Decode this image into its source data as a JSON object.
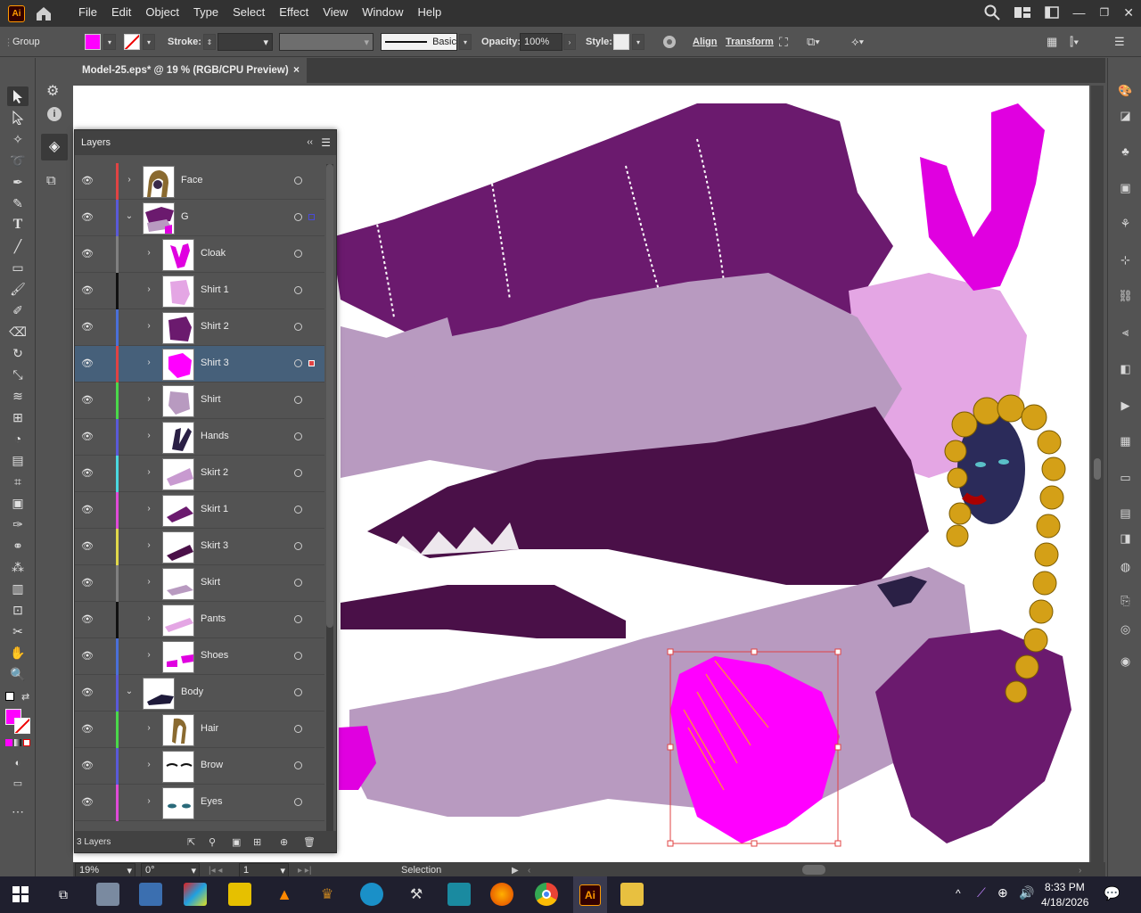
{
  "menubar": {
    "app_logo": "Ai",
    "items": [
      "File",
      "Edit",
      "Object",
      "Type",
      "Select",
      "Effect",
      "View",
      "Window",
      "Help"
    ]
  },
  "control_bar": {
    "selection_type": "Group",
    "stroke_label": "Stroke:",
    "brush_label": "Basic",
    "opacity_label": "Opacity:",
    "opacity_value": "100%",
    "style_label": "Style:",
    "align_label": "Align",
    "transform_label": "Transform",
    "fill_color": "#ff00ff"
  },
  "document": {
    "tab_title": "Model-25.eps* @ 19 % (RGB/CPU Preview)",
    "close_glyph": "×"
  },
  "layers_panel": {
    "title": "Layers",
    "footer_count": "3 Layers",
    "rows": [
      {
        "name": "Face",
        "color": "#e04343",
        "expanded": false
      },
      {
        "name": "G",
        "color": "#5a5ad8",
        "expanded": true
      },
      {
        "name": "Cloak",
        "color": "#808080",
        "expanded": false
      },
      {
        "name": "Shirt 1",
        "color": "#111111",
        "expanded": false
      },
      {
        "name": "Shirt 2",
        "color": "#4a6fd8",
        "expanded": false
      },
      {
        "name": "Shirt 3",
        "color": "#e04343",
        "expanded": false,
        "selected": true
      },
      {
        "name": "Shirt",
        "color": "#4ad84a",
        "expanded": false
      },
      {
        "name": "Hands",
        "color": "#5a5ad8",
        "expanded": false
      },
      {
        "name": "Skirt 2",
        "color": "#4ad8e0",
        "expanded": false
      },
      {
        "name": "Skirt 1",
        "color": "#e04ad8",
        "expanded": false
      },
      {
        "name": "Skirt 3",
        "color": "#e0d84a",
        "expanded": false
      },
      {
        "name": "Skirt",
        "color": "#808080",
        "expanded": false
      },
      {
        "name": "Pants",
        "color": "#111111",
        "expanded": false
      },
      {
        "name": "Shoes",
        "color": "#4a6fd8",
        "expanded": false
      },
      {
        "name": "Body",
        "color": "#5a5ad8",
        "expanded": true
      },
      {
        "name": "Hair",
        "color": "#4ad84a",
        "expanded": false
      },
      {
        "name": "Brow",
        "color": "#5a5ad8",
        "expanded": false
      },
      {
        "name": "Eyes",
        "color": "#e04ad8",
        "expanded": false
      }
    ]
  },
  "status_bar": {
    "zoom": "19%",
    "rotation": "0°",
    "artboard": "1",
    "tool": "Selection"
  },
  "taskbar": {
    "time": "8:33 PM",
    "date": "4/18/2026",
    "ai_label": "Ai"
  },
  "colors": {
    "dark_purple": "#6b1a6e",
    "magenta": "#e000e0",
    "lilac": "#b89ac0",
    "pale_pink": "#e4a6e4",
    "plum": "#4a1048"
  }
}
